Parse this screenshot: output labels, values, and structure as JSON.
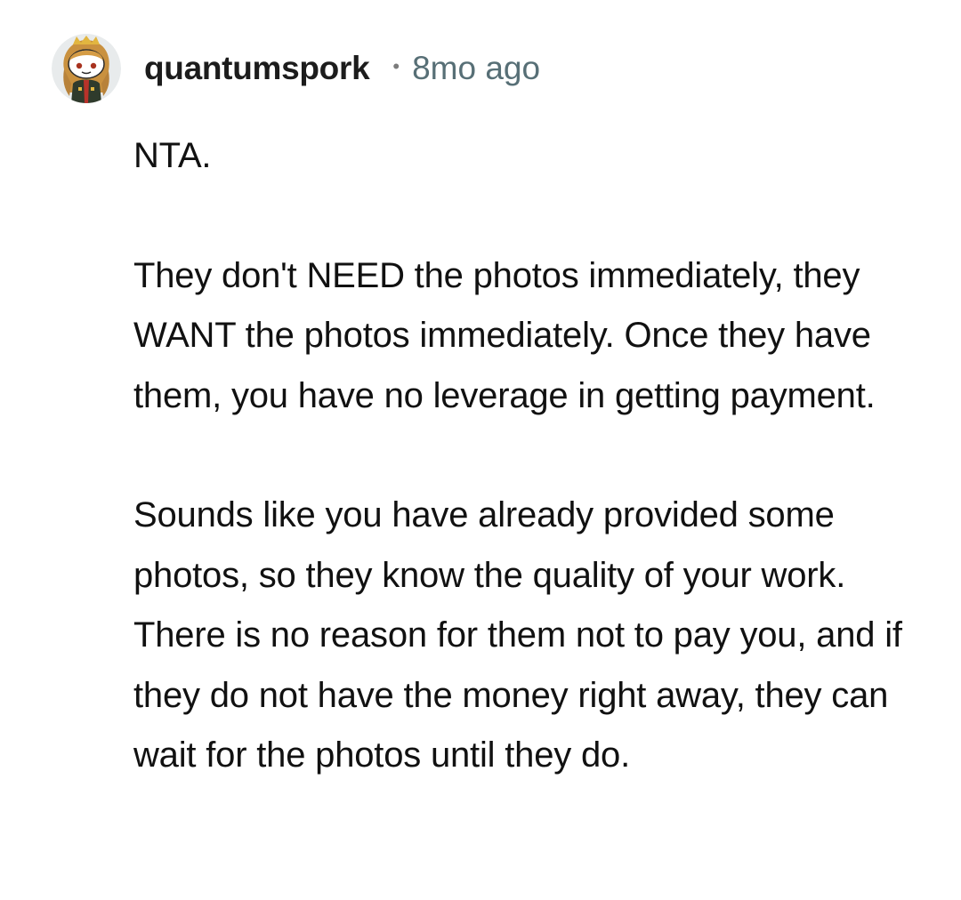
{
  "comment": {
    "author": {
      "username": "quantumspork",
      "avatar_icon": "snoo-avatar-icon"
    },
    "separator": "•",
    "timestamp": "8mo ago",
    "paragraphs": [
      "NTA.",
      "They don't NEED the photos immediately, they WANT the photos immediately. Once they have them, you have no leverage in getting payment.",
      "Sounds like you have already provided some photos, so they know the quality of your work. There is no reason for them not to pay you, and if they do not have the money right away, they can wait for the photos until they do."
    ]
  },
  "colors": {
    "username": "#1c1c1c",
    "timestamp": "#576f76",
    "body_text": "#111111",
    "background": "#ffffff"
  }
}
